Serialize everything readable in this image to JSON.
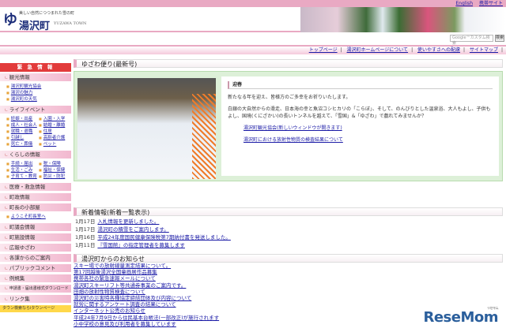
{
  "topbar": {
    "english": "English",
    "mobile": "携帯サイト"
  },
  "header": {
    "tagline": "美しい自然につつまれた雪の町",
    "town": "湯沢町",
    "town_en": "YUZAWA TOWN",
    "logo": "ゆ"
  },
  "search": {
    "placeholder": "Google™カスタム検索",
    "button": "検索"
  },
  "nav": [
    "トップページ",
    "湯沢町ホームページについて",
    "使いやすさへの配慮",
    "サイトマップ"
  ],
  "sidebar": {
    "emergency": "緊 急 情 報",
    "sightseeing": {
      "label": "観光情報",
      "links": [
        "湯沢町観光協会",
        "湯沢の魅力",
        "湯沢町の天気"
      ]
    },
    "life_event": {
      "label": "ライフイベント",
      "links": [
        "妊娠・出産",
        "入園・入学",
        "成人・社会人",
        "結婚・離婚",
        "就職・退職",
        "住居",
        "引越し",
        "高齢者介護",
        "死亡・葬儀",
        "ペット"
      ]
    },
    "living": {
      "label": "くらしの情報",
      "links": [
        "手続・届出",
        "税・保険",
        "生活・ごみ",
        "福祉・保健",
        "子育て・教育",
        "防災・防犯"
      ]
    },
    "medical": "医療・救急情報",
    "admin": "町政情報",
    "mayor": {
      "label": "町長の小部屋",
      "links": [
        "ようこそ町長室へ"
      ]
    },
    "assembly": "町議会情報",
    "facilities": "町施設情報",
    "pr": "広報ゆざわ",
    "depts": "各課からのご案内",
    "public_comment": "パブリックコメント",
    "rules": "例規集",
    "forms": "申請書・届出書様式ダウンロード",
    "links": "リンク集",
    "town_page": "タウン検索ならiタウンページ"
  },
  "featured": {
    "heading": "ゆざわ便り(最新号)",
    "title": "迎春",
    "p1": "新たなる年を迎え、皆様方のご多幸をお祈りいたします。",
    "p2": "白銀の大自然からの滑走、日本海の幸と魚沼コシヒカリの「こらぼ」、そして、のんびりとした温泉浴、大人もよし、子供もよし、国境(くにざかい)の長いトンネルを越えて、「雪国」&「ゆざわ」で戯れてみませんか？",
    "links": [
      "湯沢町観光協会(新しいウィンドウが開きます)",
      "湯沢町における放射性物質の検査結果について"
    ]
  },
  "news": {
    "heading": "新着情報(新着一覧表示)",
    "items": [
      {
        "date": "1月17日",
        "text": "入札情報を更新しました。"
      },
      {
        "date": "1月17日",
        "text": "湯沢町の積雪をご案内します。"
      },
      {
        "date": "1月16日",
        "text": "平成24年度国民健康保険税第7期納付書を発送しました。"
      },
      {
        "date": "1月11日",
        "text": "『雪国館』の指定管理者を募集します"
      }
    ]
  },
  "notices": {
    "heading": "湯沢町からのお知らせ",
    "items": [
      "スキー場での放射線量測定結果について。",
      "第17回越後湯沢全国童画展作品募集",
      "携帯各社の緊急速報メールについて",
      "湯沢町スキーリフト等共通券事業のご案内です。",
      "田畑の放射性物質検査について",
      "湯沢町の災害時各種協定締結団体及び内容について",
      "就労に関するアンケート調査の結果について",
      "インターネット公売のお知らせ",
      "平成24年7月9日から住民基本台帳法(一部改正)が施行されます",
      "小中学校の意見及び利用者を募集しています"
    ]
  },
  "watermark": {
    "text": "ReseMom",
    "sub": "リセマム"
  }
}
